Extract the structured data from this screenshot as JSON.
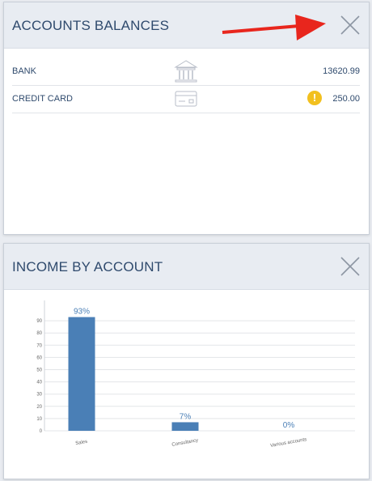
{
  "accounts_panel": {
    "title": "ACCOUNTS BALANCES",
    "rows": [
      {
        "label": "BANK",
        "icon": "bank-icon",
        "amount": "13620.99",
        "warning": false
      },
      {
        "label": "CREDIT CARD",
        "icon": "credit-card-icon",
        "amount": "250.00",
        "warning": true
      }
    ]
  },
  "income_panel": {
    "title": "INCOME BY ACCOUNT"
  },
  "colors": {
    "title": "#2f4a6d",
    "bar": "#4a7fb6",
    "warning": "#f2c01f",
    "annotation_arrow": "#e8261d"
  },
  "chart_data": {
    "type": "bar",
    "categories": [
      "Sales",
      "Consultancy",
      "Various accounts"
    ],
    "values": [
      93,
      7,
      0
    ],
    "value_labels": [
      "93%",
      "7%",
      "0%"
    ],
    "yticks": [
      0,
      10,
      20,
      30,
      40,
      50,
      60,
      70,
      80,
      90
    ],
    "ylim": [
      0,
      100
    ],
    "grid": true,
    "title": "",
    "xlabel": "",
    "ylabel": ""
  }
}
